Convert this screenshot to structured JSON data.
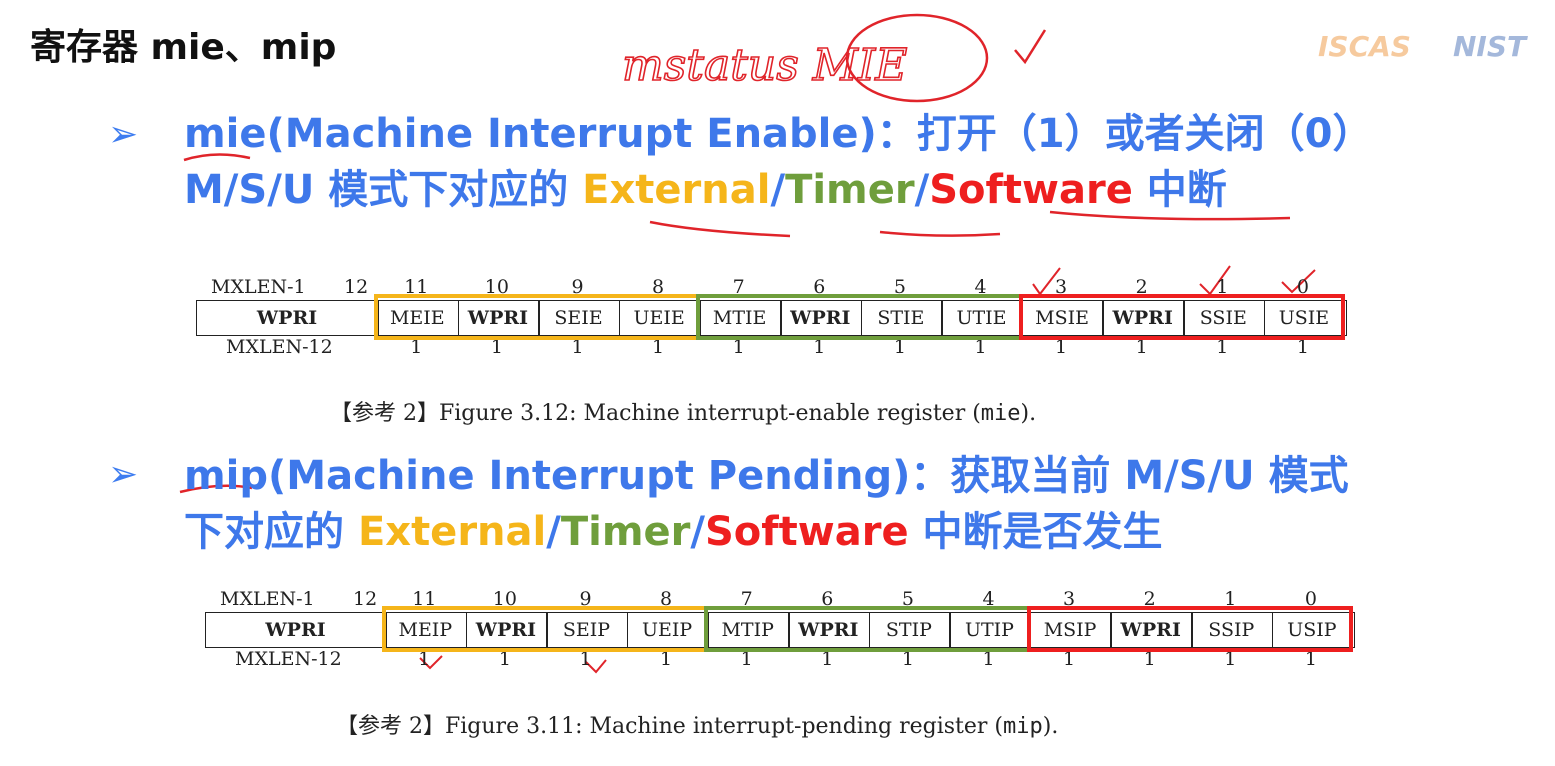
{
  "slide": {
    "title": "寄存器 mie、mip"
  },
  "logos": {
    "iscas": "ISCAS",
    "nist": "NIST"
  },
  "colors": {
    "external": "#f5b51a",
    "timer": "#6f9e3c",
    "software": "#ee1f1f",
    "heading": "#3e78ea",
    "ink": "#e0242a"
  },
  "handwriting": {
    "note": "mstatus MIE"
  },
  "sections": [
    {
      "bullet": "➢",
      "line1": "mie(Machine Interrupt Enable)：打开（1）或者关闭（0）",
      "line2_prefix": "M/S/U 模式下对应的 ",
      "external": "External",
      "slash1": "/",
      "timer": "Timer",
      "slash2": "/",
      "software": "Software",
      "line2_suffix": " 中断"
    },
    {
      "bullet": "➢",
      "line1": "mip(Machine Interrupt Pending)：获取当前 M/S/U 模式",
      "line2_prefix": "下对应的 ",
      "external": "External",
      "slash1": "/",
      "timer": "Timer",
      "slash2": "/",
      "software": "Software",
      "line2_suffix": " 中断是否发生"
    }
  ],
  "registers": [
    {
      "top_label": "MXLEN-1",
      "top_label_end": "12",
      "bottom_label": "MXLEN-12",
      "wpri": "WPRI",
      "bit_numbers": [
        "11",
        "10",
        "9",
        "8",
        "7",
        "6",
        "5",
        "4",
        "3",
        "2",
        "1",
        "0"
      ],
      "fields": [
        "MEIE",
        "WPRI",
        "SEIE",
        "UEIE",
        "MTIE",
        "WPRI",
        "STIE",
        "UTIE",
        "MSIE",
        "WPRI",
        "SSIE",
        "USIE"
      ],
      "widths": [
        "1",
        "1",
        "1",
        "1",
        "1",
        "1",
        "1",
        "1",
        "1",
        "1",
        "1",
        "1"
      ],
      "caption_ref": "【参考 2】",
      "caption_text": "Figure 3.12: Machine interrupt-enable register (",
      "caption_code": "mie",
      "caption_end": ")."
    },
    {
      "top_label": "MXLEN-1",
      "top_label_end": "12",
      "bottom_label": "MXLEN-12",
      "wpri": "WPRI",
      "bit_numbers": [
        "11",
        "10",
        "9",
        "8",
        "7",
        "6",
        "5",
        "4",
        "3",
        "2",
        "1",
        "0"
      ],
      "fields": [
        "MEIP",
        "WPRI",
        "SEIP",
        "UEIP",
        "MTIP",
        "WPRI",
        "STIP",
        "UTIP",
        "MSIP",
        "WPRI",
        "SSIP",
        "USIP"
      ],
      "widths": [
        "1",
        "1",
        "1",
        "1",
        "1",
        "1",
        "1",
        "1",
        "1",
        "1",
        "1",
        "1"
      ],
      "caption_ref": "【参考 2】",
      "caption_text": "Figure 3.11: Machine interrupt-pending register (",
      "caption_code": "mip",
      "caption_end": ")."
    }
  ]
}
